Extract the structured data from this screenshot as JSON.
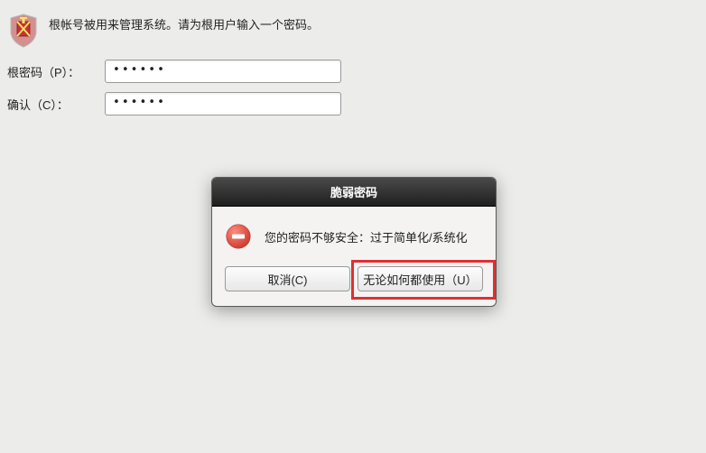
{
  "header": {
    "instruction": "根帐号被用来管理系统。请为根用户输入一个密码。"
  },
  "form": {
    "password_label": "根密码（P）：",
    "password_value": "••••••",
    "confirm_label": "确认（C）：",
    "confirm_value": "••••••"
  },
  "dialog": {
    "title": "脆弱密码",
    "message": "您的密码不够安全：过于简单化/系统化",
    "cancel_label": "取消(C)",
    "use_anyway_label": "无论如何都使用（U）"
  },
  "icons": {
    "shield": "shield-icon",
    "error": "error-icon"
  }
}
